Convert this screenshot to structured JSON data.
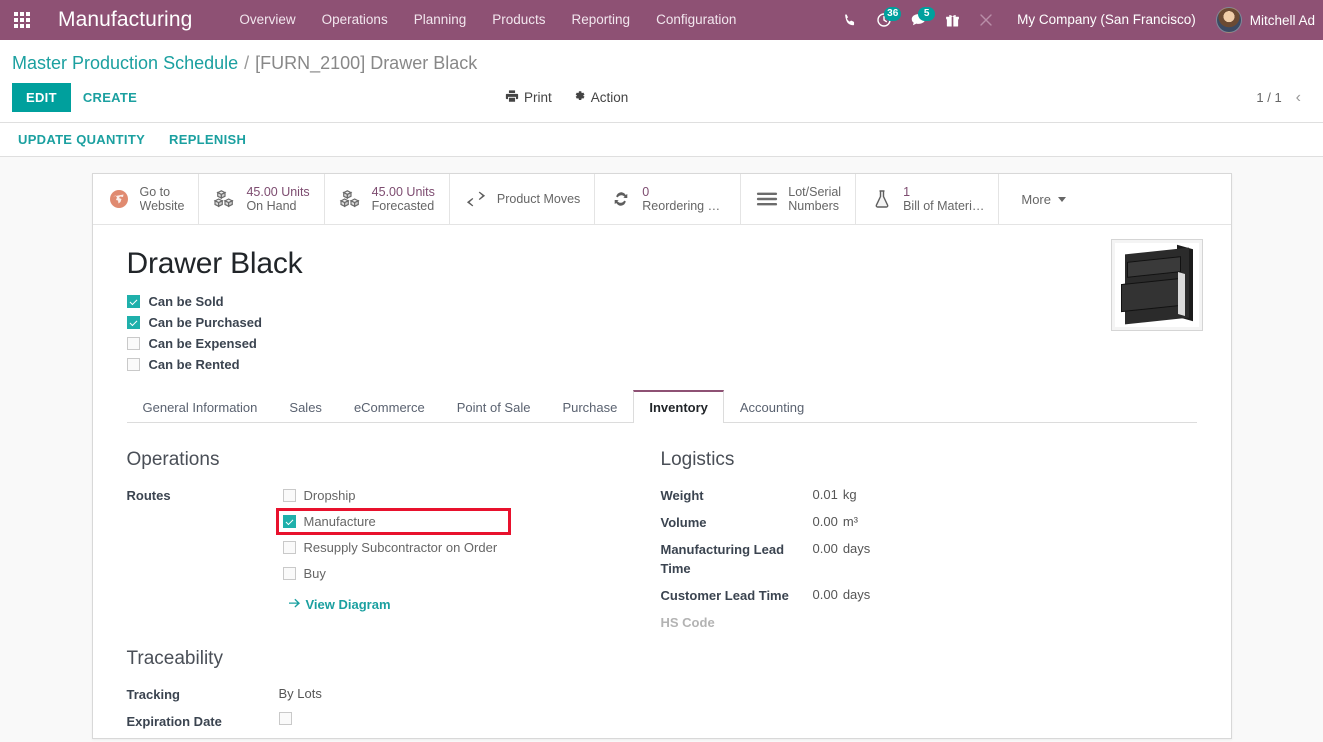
{
  "navbar": {
    "apps_icon": "apps-grid-icon",
    "brand": "Manufacturing",
    "menu": [
      {
        "label": "Overview"
      },
      {
        "label": "Operations"
      },
      {
        "label": "Planning"
      },
      {
        "label": "Products"
      },
      {
        "label": "Reporting"
      },
      {
        "label": "Configuration"
      }
    ],
    "icons": [
      {
        "name": "phone-icon",
        "badge": null
      },
      {
        "name": "activity-clock-icon",
        "badge": "36"
      },
      {
        "name": "messages-icon",
        "badge": "5"
      },
      {
        "name": "gift-icon",
        "badge": null
      },
      {
        "name": "developer-tools-icon",
        "badge": null
      }
    ],
    "company": "My Company (San Francisco)",
    "user_name": "Mitchell Ad",
    "colors": {
      "bar": "#8e5174",
      "badge": "#00a09d"
    }
  },
  "control_panel": {
    "breadcrumb": {
      "parent": "Master Production Schedule",
      "separator": "/",
      "current": "[FURN_2100] Drawer Black"
    },
    "edit_label": "EDIT",
    "create_label": "CREATE",
    "print_label": "Print",
    "action_label": "Action",
    "pager_count": "1 / 1",
    "pager_prev": "‹",
    "sub_buttons": [
      {
        "label": "UPDATE QUANTITY"
      },
      {
        "label": "REPLENISH"
      }
    ]
  },
  "stat_buttons": [
    {
      "icon": "globe-icon",
      "value": "",
      "label": "Go to",
      "label2": "Website"
    },
    {
      "icon": "boxes-icon",
      "value": "45.00 Units",
      "label": "On Hand",
      "label2": ""
    },
    {
      "icon": "boxes-icon",
      "value": "45.00 Units",
      "label": "Forecasted",
      "label2": ""
    },
    {
      "icon": "exchange-icon",
      "value": "",
      "label": "Product Moves",
      "label2": ""
    },
    {
      "icon": "refresh-icon",
      "value": "0",
      "label": "Reordering R…",
      "label2": ""
    },
    {
      "icon": "bars-icon",
      "value": "",
      "label": "Lot/Serial",
      "label2": "Numbers"
    },
    {
      "icon": "flask-icon",
      "value": "1",
      "label": "Bill of Materi…",
      "label2": ""
    }
  ],
  "stat_more": "More",
  "product": {
    "title": "Drawer Black",
    "image_alt": "product-thumbnail-drawer-black",
    "flags": [
      {
        "label": "Can be Sold",
        "checked": true
      },
      {
        "label": "Can be Purchased",
        "checked": true
      },
      {
        "label": "Can be Expensed",
        "checked": false
      },
      {
        "label": "Can be Rented",
        "checked": false
      }
    ]
  },
  "tabs": [
    {
      "label": "General Information",
      "active": false
    },
    {
      "label": "Sales",
      "active": false
    },
    {
      "label": "eCommerce",
      "active": false
    },
    {
      "label": "Point of Sale",
      "active": false
    },
    {
      "label": "Purchase",
      "active": false
    },
    {
      "label": "Inventory",
      "active": true
    },
    {
      "label": "Accounting",
      "active": false
    }
  ],
  "inventory": {
    "operations": {
      "title": "Operations",
      "routes_label": "Routes",
      "routes": [
        {
          "label": "Dropship",
          "checked": false,
          "highlighted": false
        },
        {
          "label": "Manufacture",
          "checked": true,
          "highlighted": true
        },
        {
          "label": "Resupply Subcontractor on Order",
          "checked": false,
          "highlighted": false
        },
        {
          "label": "Buy",
          "checked": false,
          "highlighted": false
        }
      ],
      "view_diagram": "View Diagram",
      "view_diagram_icon": "arrow-right-icon"
    },
    "logistics": {
      "title": "Logistics",
      "fields": [
        {
          "label": "Weight",
          "value": "0.01",
          "unit": "kg",
          "muted": false
        },
        {
          "label": "Volume",
          "value": "0.00",
          "unit": "m³",
          "muted": false
        },
        {
          "label": "Manufacturing Lead Time",
          "value": "0.00",
          "unit": "days",
          "muted": false
        },
        {
          "label": "Customer Lead Time",
          "value": "0.00",
          "unit": "days",
          "muted": false
        },
        {
          "label": "HS Code",
          "value": "",
          "unit": "",
          "muted": true
        }
      ]
    },
    "traceability": {
      "title": "Traceability",
      "tracking_label": "Tracking",
      "tracking_value": "By Lots",
      "expiration_label": "Expiration Date",
      "expiration_checked": false
    }
  },
  "highlight_color": "#e8112d"
}
